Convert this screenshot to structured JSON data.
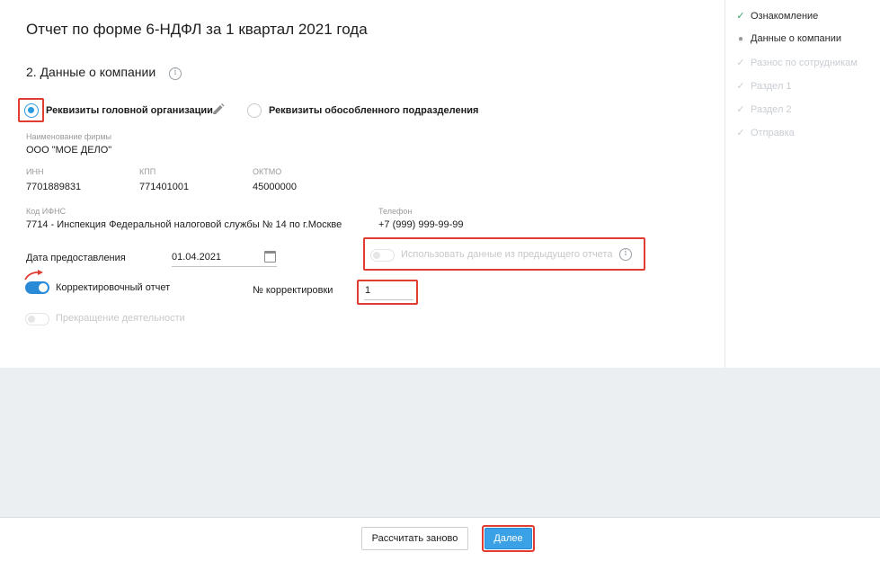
{
  "page": {
    "title": "Отчет по форме 6-НДФЛ за 1 квартал 2021 года",
    "section_title": "2. Данные о компании"
  },
  "radios": {
    "head_org": "Реквизиты головной организации",
    "branch": "Реквизиты обособленного подразделения"
  },
  "company": {
    "name_label": "Наименование фирмы",
    "name": "ООО \"МОЕ ДЕЛО\"",
    "inn_label": "ИНН",
    "inn": "7701889831",
    "kpp_label": "КПП",
    "kpp": "771401001",
    "oktmo_label": "ОКТМО",
    "oktmo": "45000000",
    "ifns_label": "Код ИФНС",
    "ifns": "7714 - Инспекция Федеральной налоговой службы № 14 по г.Москве",
    "phone_label": "Телефон",
    "phone": "+7 (999) 999-99-99"
  },
  "form": {
    "date_label": "Дата предоставления",
    "date_value": "01.04.2021",
    "use_prev_label": "Использовать данные из предыдущего отчета",
    "correction_label": "Корректировочный отчет",
    "correction_num_label": "№ корректировки",
    "correction_num_value": "1",
    "termination_label": "Прекращение деятельности"
  },
  "steps": [
    {
      "label": "Ознакомление",
      "state": "done"
    },
    {
      "label": "Данные о компании",
      "state": "current"
    },
    {
      "label": "Разнос по сотрудникам",
      "state": "future"
    },
    {
      "label": "Раздел 1",
      "state": "future"
    },
    {
      "label": "Раздел 2",
      "state": "future"
    },
    {
      "label": "Отправка",
      "state": "future"
    }
  ],
  "footer": {
    "recalc_label": "Рассчитать заново",
    "next_label": "Далее"
  },
  "colors": {
    "accent": "#2b99e0",
    "highlight": "#e03c32",
    "done_check": "#3aa46a"
  },
  "icons": {
    "info": "info-circle-icon",
    "edit": "pencil-icon",
    "calendar": "calendar-icon",
    "arrow": "curved-arrow-icon",
    "check": "check-icon"
  }
}
